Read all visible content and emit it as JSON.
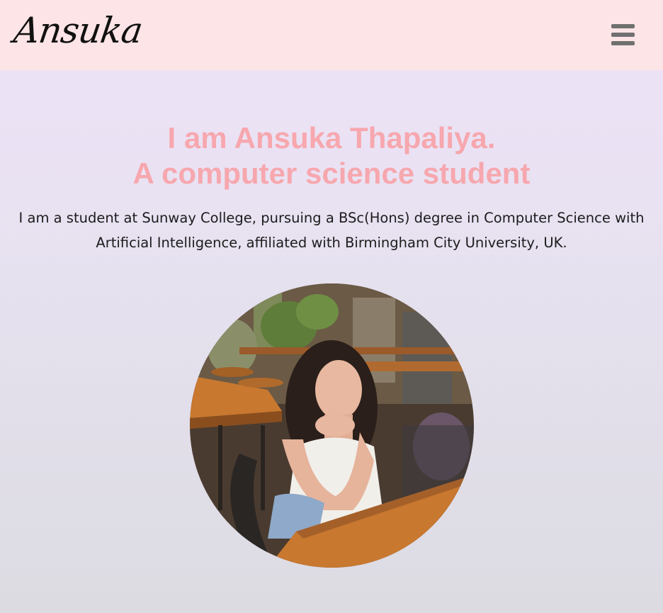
{
  "header": {
    "logo_text": "Ansuka",
    "menu_icon": "hamburger-menu-icon",
    "background_color": "#fde4e6"
  },
  "hero": {
    "title_line1": "I am Ansuka Thapaliya.",
    "title_line2": "A computer science student",
    "title_color": "#f7a7ae",
    "description": "I am a student at Sunway College, pursuing a BSc(Hons) degree in Computer Science with Artificial Intelligence, affiliated with Birmingham City University, UK."
  },
  "profile_photo": {
    "shape": "circle",
    "subject": "profile-photo"
  }
}
